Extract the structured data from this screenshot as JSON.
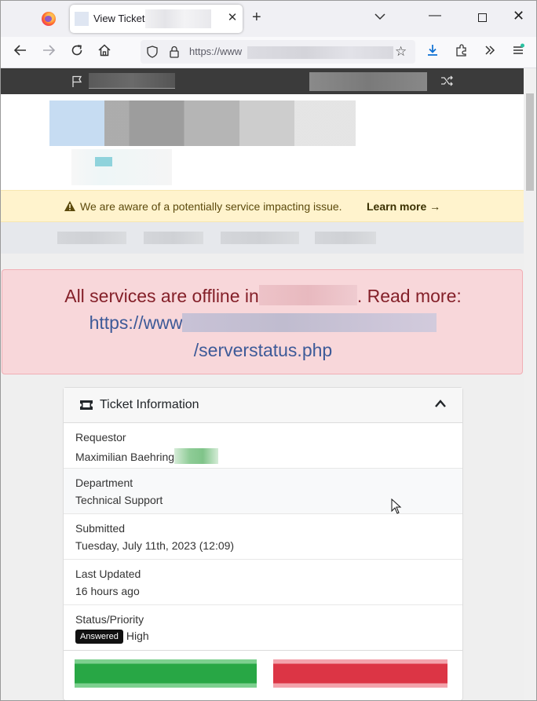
{
  "browser": {
    "tab_title": "View Ticket",
    "tab_close": "✕",
    "new_tab": "+",
    "url_prefix": "https://www"
  },
  "alert_banner": {
    "text": "We are aware of a potentially service impacting issue.",
    "link": "Learn more →"
  },
  "offline_alert": {
    "line1_before": "All services are offline in",
    "line1_after": ". Read more:",
    "line2_prefix": "https://www",
    "line3": "/serverstatus.php"
  },
  "ticket_card": {
    "title": "Ticket Information",
    "rows": [
      {
        "label": "Requestor",
        "value": "Maximilian Baehring"
      },
      {
        "label": "Department",
        "value": "Technical Support"
      },
      {
        "label": "Submitted",
        "value": "Tuesday, July 11th, 2023 (12:09)"
      },
      {
        "label": "Last Updated",
        "value": "16 hours ago"
      },
      {
        "label": "Status/Priority",
        "status_badge": "Answered",
        "priority": "High"
      }
    ]
  },
  "colors": {
    "alert_bg": "#fff3cd",
    "offline_bg": "#f8d7da",
    "offline_text": "#842029",
    "link": "#3d5a98",
    "success": "#28a745",
    "danger": "#dc3545"
  },
  "icons": [
    "firefox-icon",
    "close-icon",
    "plus-icon",
    "chevron-down-icon",
    "back-icon",
    "forward-icon",
    "reload-icon",
    "home-icon",
    "shield-icon",
    "lock-icon",
    "star-icon",
    "download-icon",
    "extensions-icon",
    "overflow-icon",
    "menu-icon",
    "flag-icon",
    "shuffle-icon",
    "warning-icon",
    "ticket-icon",
    "chevron-up-icon",
    "cursor-icon"
  ]
}
